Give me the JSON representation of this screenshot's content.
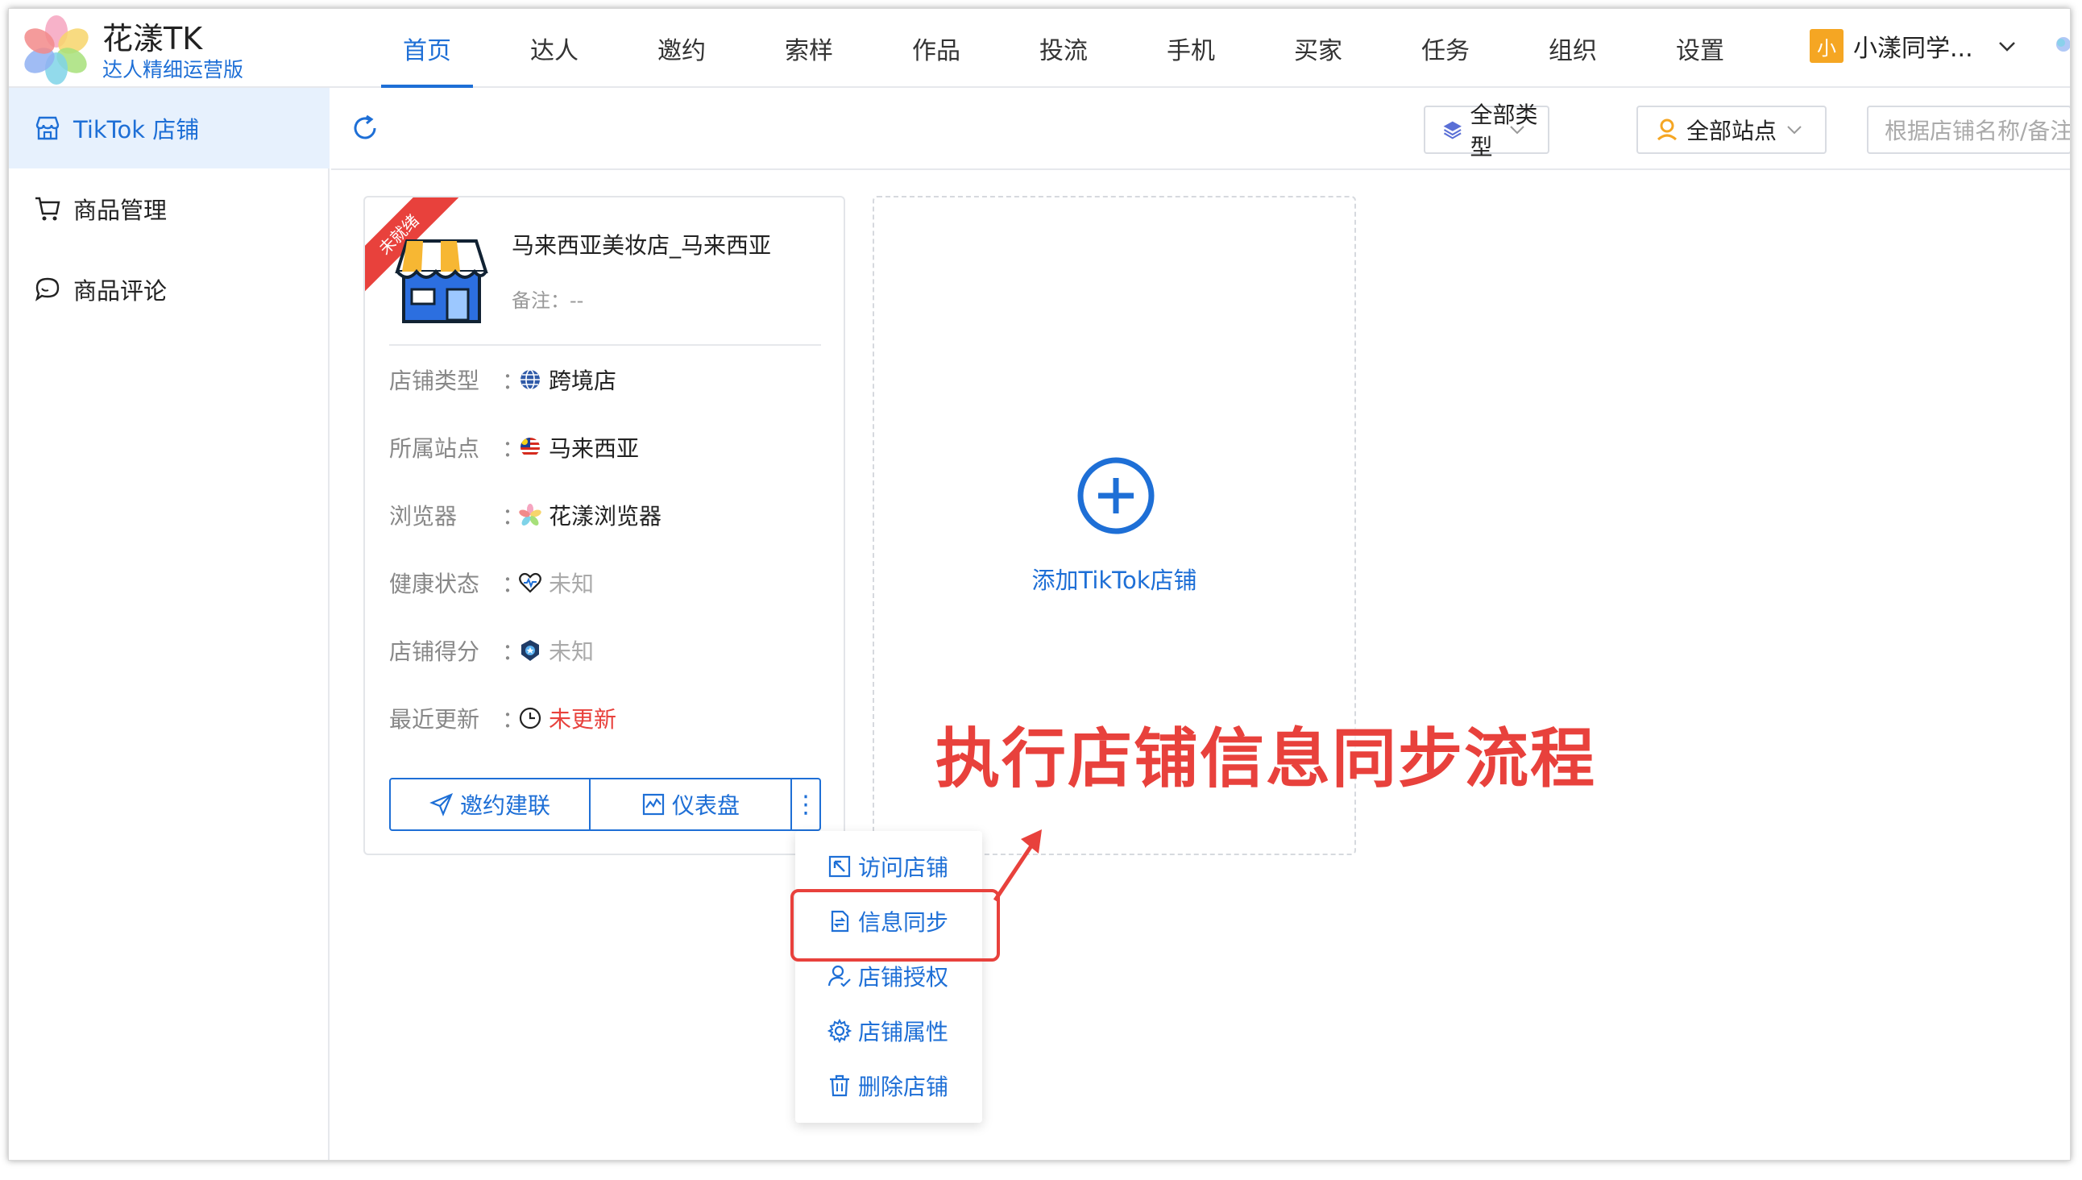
{
  "app": {
    "brand_title": "花漾TK",
    "brand_subtitle": "达人精细运营版"
  },
  "nav": {
    "items": [
      "首页",
      "达人",
      "邀约",
      "索样",
      "作品",
      "投流",
      "手机",
      "买家",
      "任务",
      "组织",
      "设置"
    ],
    "active_index": 0
  },
  "user": {
    "avatar_text": "小",
    "name": "小漾同学..."
  },
  "sidebar": {
    "items": [
      {
        "label": "TikTok 店铺",
        "icon": "store-icon",
        "active": true
      },
      {
        "label": "商品管理",
        "icon": "cart-icon",
        "active": false
      },
      {
        "label": "商品评论",
        "icon": "comment-icon",
        "active": false
      }
    ]
  },
  "toolbar": {
    "type_select": "全部类型",
    "site_select": "全部站点",
    "search_placeholder": "根据店铺名称/备注"
  },
  "shop": {
    "ribbon": "未就绪",
    "name": "马来西亚美妆店_马来西亚",
    "note": "备注：--",
    "rows": [
      {
        "label": "店铺类型",
        "value": "跨境店",
        "icon": "globe-icon"
      },
      {
        "label": "所属站点",
        "value": "马来西亚",
        "icon": "malaysia-flag-icon"
      },
      {
        "label": "浏览器",
        "value": "花漾浏览器",
        "icon": "browser-logo-icon"
      },
      {
        "label": "健康状态",
        "value": "未知",
        "icon": "heart-pulse-icon"
      },
      {
        "label": "店铺得分",
        "value": "未知",
        "icon": "badge-icon"
      },
      {
        "label": "最近更新",
        "value": "未更新",
        "icon": "clock-icon"
      }
    ],
    "colon": "：",
    "btn_invite": "邀约建联",
    "btn_dashboard": "仪表盘",
    "btn_more": "⋮"
  },
  "add_card": {
    "label": "添加TikTok店铺"
  },
  "menu": {
    "items": [
      "访问店铺",
      "信息同步",
      "店铺授权",
      "店铺属性",
      "删除店铺"
    ],
    "highlighted_index": 1
  },
  "annotation": {
    "text": "执行店铺信息同步流程"
  },
  "colors": {
    "primary": "#1e6fd6",
    "danger": "#e8413c",
    "active_bg": "#e7f1fd"
  }
}
